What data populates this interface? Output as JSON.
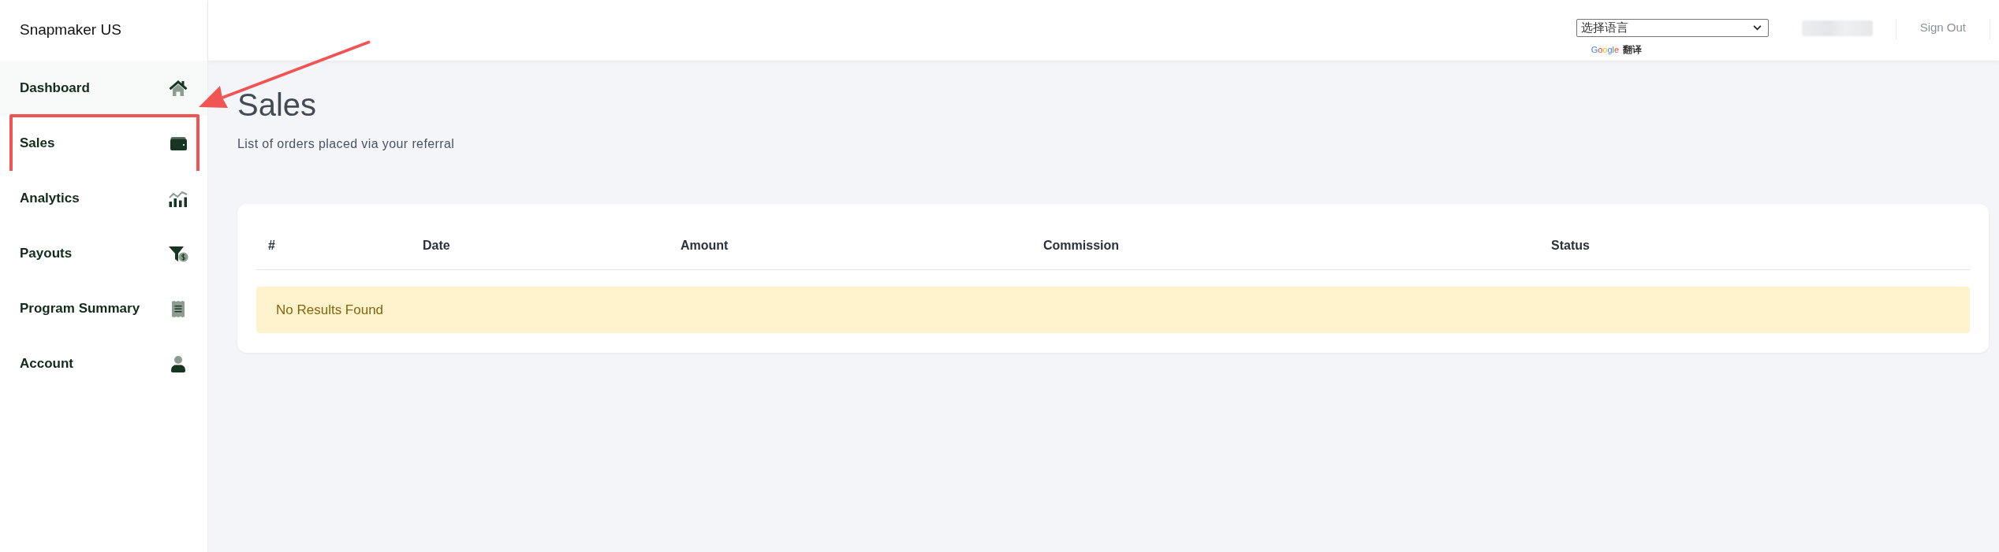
{
  "sidebar": {
    "brand": "Snapmaker US",
    "items": [
      {
        "label": "Dashboard",
        "selected": true,
        "highlighted": false
      },
      {
        "label": "Sales",
        "selected": false,
        "highlighted": true
      },
      {
        "label": "Analytics",
        "selected": false,
        "highlighted": false
      },
      {
        "label": "Payouts",
        "selected": false,
        "highlighted": false
      },
      {
        "label": "Program Summary",
        "selected": false,
        "highlighted": false
      },
      {
        "label": "Account",
        "selected": false,
        "highlighted": false
      }
    ]
  },
  "top_bar": {
    "language_select": {
      "value": "选择语言"
    },
    "translate_credit": {
      "brand": "Google",
      "label": "翻译"
    },
    "sign_out": "Sign Out"
  },
  "page": {
    "title": "Sales",
    "subtitle": "List of orders placed via your referral"
  },
  "table": {
    "columns": [
      "#",
      "Date",
      "Amount",
      "Commission",
      "Status"
    ],
    "empty_message": "No Results Found"
  }
}
